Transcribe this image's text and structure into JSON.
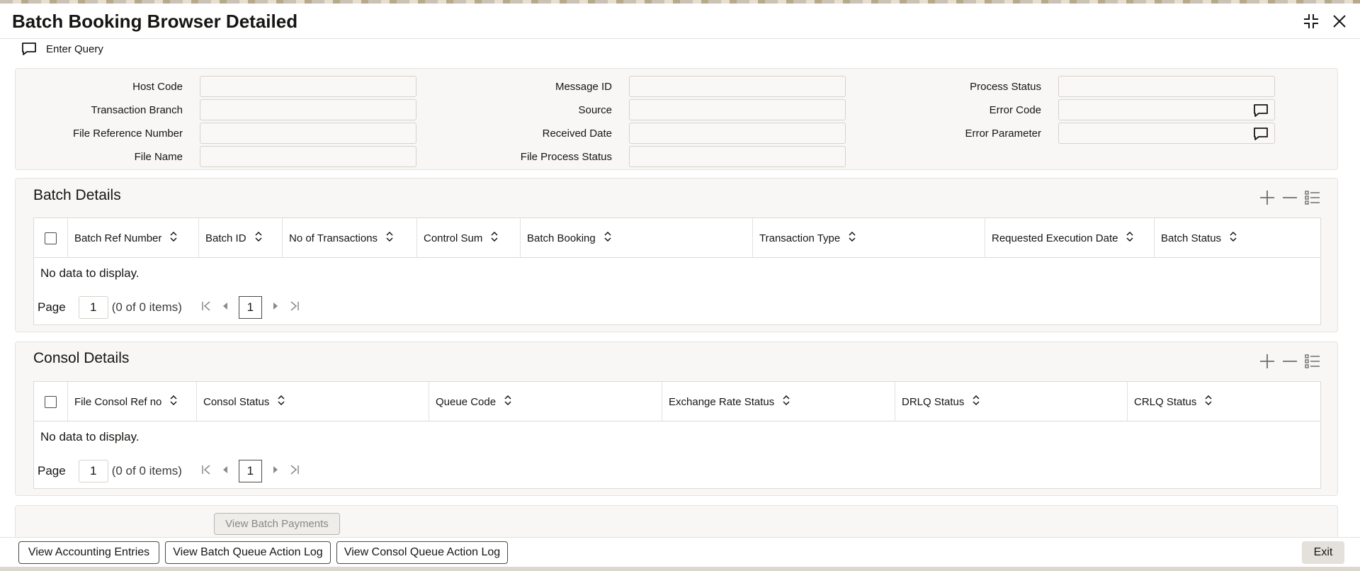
{
  "window": {
    "title": "Batch Booking Browser Detailed"
  },
  "toolbar": {
    "enter_query": "Enter Query"
  },
  "query": {
    "host_code": "Host Code",
    "transaction_branch": "Transaction Branch",
    "file_reference_number": "File Reference Number",
    "file_name": "File Name",
    "message_id": "Message ID",
    "source": "Source",
    "received_date": "Received Date",
    "file_process_status": "File Process Status",
    "process_status": "Process Status",
    "error_code": "Error Code",
    "error_parameter": "Error Parameter"
  },
  "batch": {
    "title": "Batch Details",
    "columns": [
      "Batch Ref Number",
      "Batch ID",
      "No of Transactions",
      "Control Sum",
      "Batch Booking",
      "Transaction Type",
      "Requested Execution Date",
      "Batch Status"
    ],
    "no_data": "No data to display.",
    "pager": {
      "label": "Page",
      "page": "1",
      "info": "(0 of 0 items)",
      "current": "1"
    }
  },
  "consol": {
    "title": "Consol Details",
    "columns": [
      "File Consol Ref no",
      "Consol Status",
      "Queue Code",
      "Exchange Rate Status",
      "DRLQ Status",
      "CRLQ Status"
    ],
    "no_data": "No data to display.",
    "pager": {
      "label": "Page",
      "page": "1",
      "info": "(0 of 0 items)",
      "current": "1"
    }
  },
  "actions": {
    "view_batch_payments": "View Batch Payments",
    "view_accounting_entries": "View Accounting Entries",
    "view_batch_queue_log": "View Batch Queue Action Log",
    "view_consol_queue_log": "View Consol Queue Action Log",
    "exit": "Exit"
  }
}
